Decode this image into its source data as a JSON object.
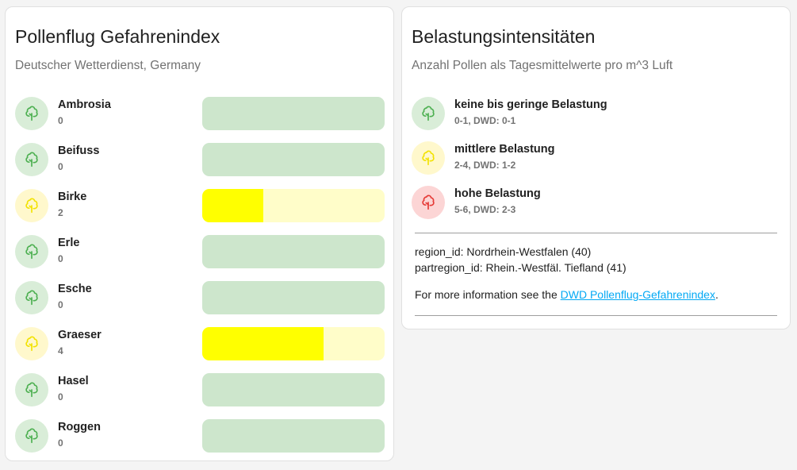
{
  "colors": {
    "green_bg": "#cde6cc",
    "green_icon_bg": "#d9edd8",
    "green_icon": "#4caf50",
    "yellow_track": "#fffdc9",
    "yellow_fill": "#ffff00",
    "yellow_icon_bg": "#fff8cc",
    "yellow_icon": "#f2e200",
    "red_icon_bg": "#fcd5d5",
    "red_icon": "#e53935",
    "link": "#03a9f4"
  },
  "left_card": {
    "title": "Pollenflug Gefahrenindex",
    "subtitle": "Deutscher Wetterdienst,  Germany",
    "items": [
      {
        "name": "Ambrosia",
        "value": "0",
        "level": "green",
        "fill_fraction": 0
      },
      {
        "name": "Beifuss",
        "value": "0",
        "level": "green",
        "fill_fraction": 0
      },
      {
        "name": "Birke",
        "value": "2",
        "level": "yellow",
        "fill_fraction": 0.333
      },
      {
        "name": "Erle",
        "value": "0",
        "level": "green",
        "fill_fraction": 0
      },
      {
        "name": "Esche",
        "value": "0",
        "level": "green",
        "fill_fraction": 0
      },
      {
        "name": "Graeser",
        "value": "4",
        "level": "yellow",
        "fill_fraction": 0.667
      },
      {
        "name": "Hasel",
        "value": "0",
        "level": "green",
        "fill_fraction": 0
      },
      {
        "name": "Roggen",
        "value": "0",
        "level": "green",
        "fill_fraction": 0
      }
    ]
  },
  "right_card": {
    "title": "Belastungsintensitäten",
    "subtitle": "Anzahl Pollen als Tagesmittelwerte pro m^3 Luft",
    "legend": [
      {
        "name": "keine bis geringe Belastung",
        "desc": "0-1, DWD: 0-1",
        "level": "green"
      },
      {
        "name": "mittlere Belastung",
        "desc": "2-4, DWD: 1-2",
        "level": "yellow"
      },
      {
        "name": "hohe Belastung",
        "desc": "5-6, DWD: 2-3",
        "level": "red"
      }
    ],
    "region_id": "region_id: Nordrhein-Westfalen (40)",
    "partregion_id": "partregion_id: Rhein.-Westfäl. Tiefland (41)",
    "more_info_prefix": "For more information see the ",
    "more_info_link": "DWD Pollenflug-Gefahrenindex",
    "more_info_suffix": "."
  },
  "icon_name": "tree-icon"
}
